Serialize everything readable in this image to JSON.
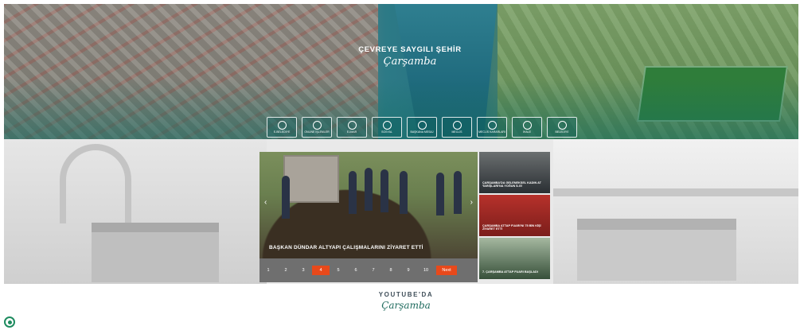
{
  "hero": {
    "slogan_line": "ÇEVREYE SAYGILI ŞEHİR",
    "slogan_script": "Çarşamba",
    "quick_links": [
      {
        "label": "E-BELEDİYE",
        "icon": "e-belediye-icon"
      },
      {
        "label": "ONLINE İŞLEMLER",
        "icon": "online-icon"
      },
      {
        "label": "E-İMAR",
        "icon": "imar-icon"
      },
      {
        "label": "SOSYAL",
        "icon": "social-icon"
      },
      {
        "label": "BAŞKANA MESAJ",
        "icon": "message-icon"
      },
      {
        "label": "MECLİS",
        "icon": "council-icon"
      },
      {
        "label": "MECLİS KARARLARI",
        "icon": "decisions-icon"
      },
      {
        "label": "İHALE",
        "icon": "tender-icon"
      },
      {
        "label": "BELEDİYE",
        "icon": "municipality-icon"
      }
    ]
  },
  "slider": {
    "caption": "BAŞKAN DÜNDAR ALTYAPI ÇALIŞMALARINI ZİYARET ETTİ",
    "pages": [
      "1",
      "2",
      "3",
      "4",
      "5",
      "6",
      "7",
      "8",
      "9",
      "10"
    ],
    "active_page": "4",
    "next_label": "Next",
    "prev_arrow": "‹",
    "next_arrow": "›"
  },
  "side_news": [
    {
      "title": "ÇARŞAMBA'DA GELENEKSEL KADIN AT YARIŞLARI'NA YOĞUN İLGİ"
    },
    {
      "title": "ÇARŞAMBA ATTAP FUARI'NI 75 BİN KİŞİ ZİYARET ETTİ"
    },
    {
      "title": "7. ÇARŞAMBA ATTAP FUARI BAŞLADI"
    }
  ],
  "youtube": {
    "title": "YOUTUBE'DA",
    "script": "Çarşamba"
  },
  "accessibility": {
    "icon": "accessibility-icon"
  }
}
